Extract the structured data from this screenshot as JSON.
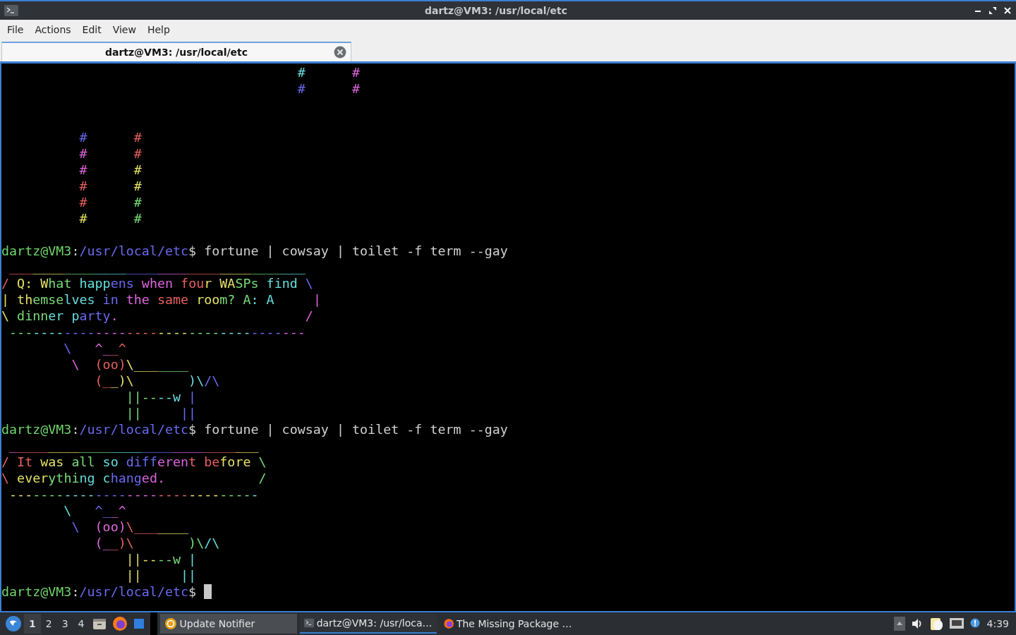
{
  "window": {
    "title": "dartz@VM3: /usr/local/etc"
  },
  "menu": [
    "File",
    "Actions",
    "Edit",
    "View",
    "Help"
  ],
  "tabs": [
    {
      "label": "dartz@VM3: /usr/local/etc",
      "selected": true
    }
  ],
  "terminal": {
    "lines": [
      {
        "kind": "output",
        "segments": [
          "                                      #",
          "      #"
        ]
      },
      {
        "kind": "output",
        "segments": [
          "                                      #",
          "      #"
        ]
      },
      {
        "kind": "blank"
      },
      {
        "kind": "blank"
      },
      {
        "kind": "output",
        "segments": [
          "          #",
          "      #"
        ]
      },
      {
        "kind": "output",
        "segments": [
          "          #",
          "      #"
        ]
      },
      {
        "kind": "output",
        "segments": [
          "          #",
          "      #"
        ]
      },
      {
        "kind": "output",
        "segments": [
          "          #",
          "      #"
        ]
      },
      {
        "kind": "output",
        "segments": [
          "          #",
          "      #"
        ]
      },
      {
        "kind": "output",
        "segments": [
          "          #",
          "      #"
        ]
      },
      {
        "kind": "blank"
      },
      {
        "kind": "prompt",
        "user_host": "dartz@VM3",
        "separator": ":",
        "path": "/usr/local/etc",
        "symbol": "$",
        "command": "fortune | cowsay | toilet -f term --gay"
      },
      {
        "kind": "output",
        "segments": [
          " ______________________________________"
        ]
      },
      {
        "kind": "output",
        "segments": [
          "/ Q: What happens when four WASPs find \\"
        ]
      },
      {
        "kind": "output",
        "segments": [
          "| themselves in the same room? A: A",
          "     |"
        ]
      },
      {
        "kind": "output",
        "segments": [
          "\\ dinner party.",
          "                        /"
        ]
      },
      {
        "kind": "output",
        "segments": [
          " --------------------------------------"
        ]
      },
      {
        "kind": "output",
        "segments": [
          "        \\",
          "   ^__^"
        ]
      },
      {
        "kind": "output",
        "segments": [
          "         \\",
          "  (oo)\\_______"
        ]
      },
      {
        "kind": "output",
        "segments": [
          "            (__)\\",
          "       )\\/\\"
        ]
      },
      {
        "kind": "output",
        "segments": [
          "                ||----w |"
        ]
      },
      {
        "kind": "output",
        "segments": [
          "                ||",
          "     ||"
        ]
      },
      {
        "kind": "prompt",
        "user_host": "dartz@VM3",
        "separator": ":",
        "path": "/usr/local/etc",
        "symbol": "$",
        "command": "fortune | cowsay | toilet -f term --gay"
      },
      {
        "kind": "output",
        "segments": [
          " ________________________________"
        ]
      },
      {
        "kind": "output",
        "segments": [
          "/ It was all so different before \\"
        ]
      },
      {
        "kind": "output",
        "segments": [
          "\\ everything changed.",
          "            /"
        ]
      },
      {
        "kind": "output",
        "segments": [
          " --------------------------------"
        ]
      },
      {
        "kind": "output",
        "segments": [
          "        \\",
          "   ^__^"
        ]
      },
      {
        "kind": "output",
        "segments": [
          "         \\",
          "  (oo)\\_______"
        ]
      },
      {
        "kind": "output",
        "segments": [
          "            (__)\\",
          "       )\\/\\"
        ]
      },
      {
        "kind": "output",
        "segments": [
          "                ||----w |"
        ]
      },
      {
        "kind": "output",
        "segments": [
          "                ||",
          "     ||"
        ]
      },
      {
        "kind": "prompt",
        "user_host": "dartz@VM3",
        "separator": ":",
        "path": "/usr/local/etc",
        "symbol": "$",
        "cursor": true
      }
    ]
  },
  "taskbar": {
    "workspaces": [
      {
        "label": "1",
        "selected": true
      },
      {
        "label": "2",
        "selected": false
      },
      {
        "label": "3",
        "selected": false
      },
      {
        "label": "4",
        "selected": false
      }
    ],
    "tasks": [
      {
        "kind": "notifier",
        "label": "Update Notifier",
        "selected": false
      },
      {
        "kind": "terminal",
        "label": "dartz@VM3: /usr/loca…",
        "selected": true
      },
      {
        "kind": "browser",
        "label": "The Missing Package …",
        "selected": false
      }
    ],
    "clock": "4:39"
  }
}
